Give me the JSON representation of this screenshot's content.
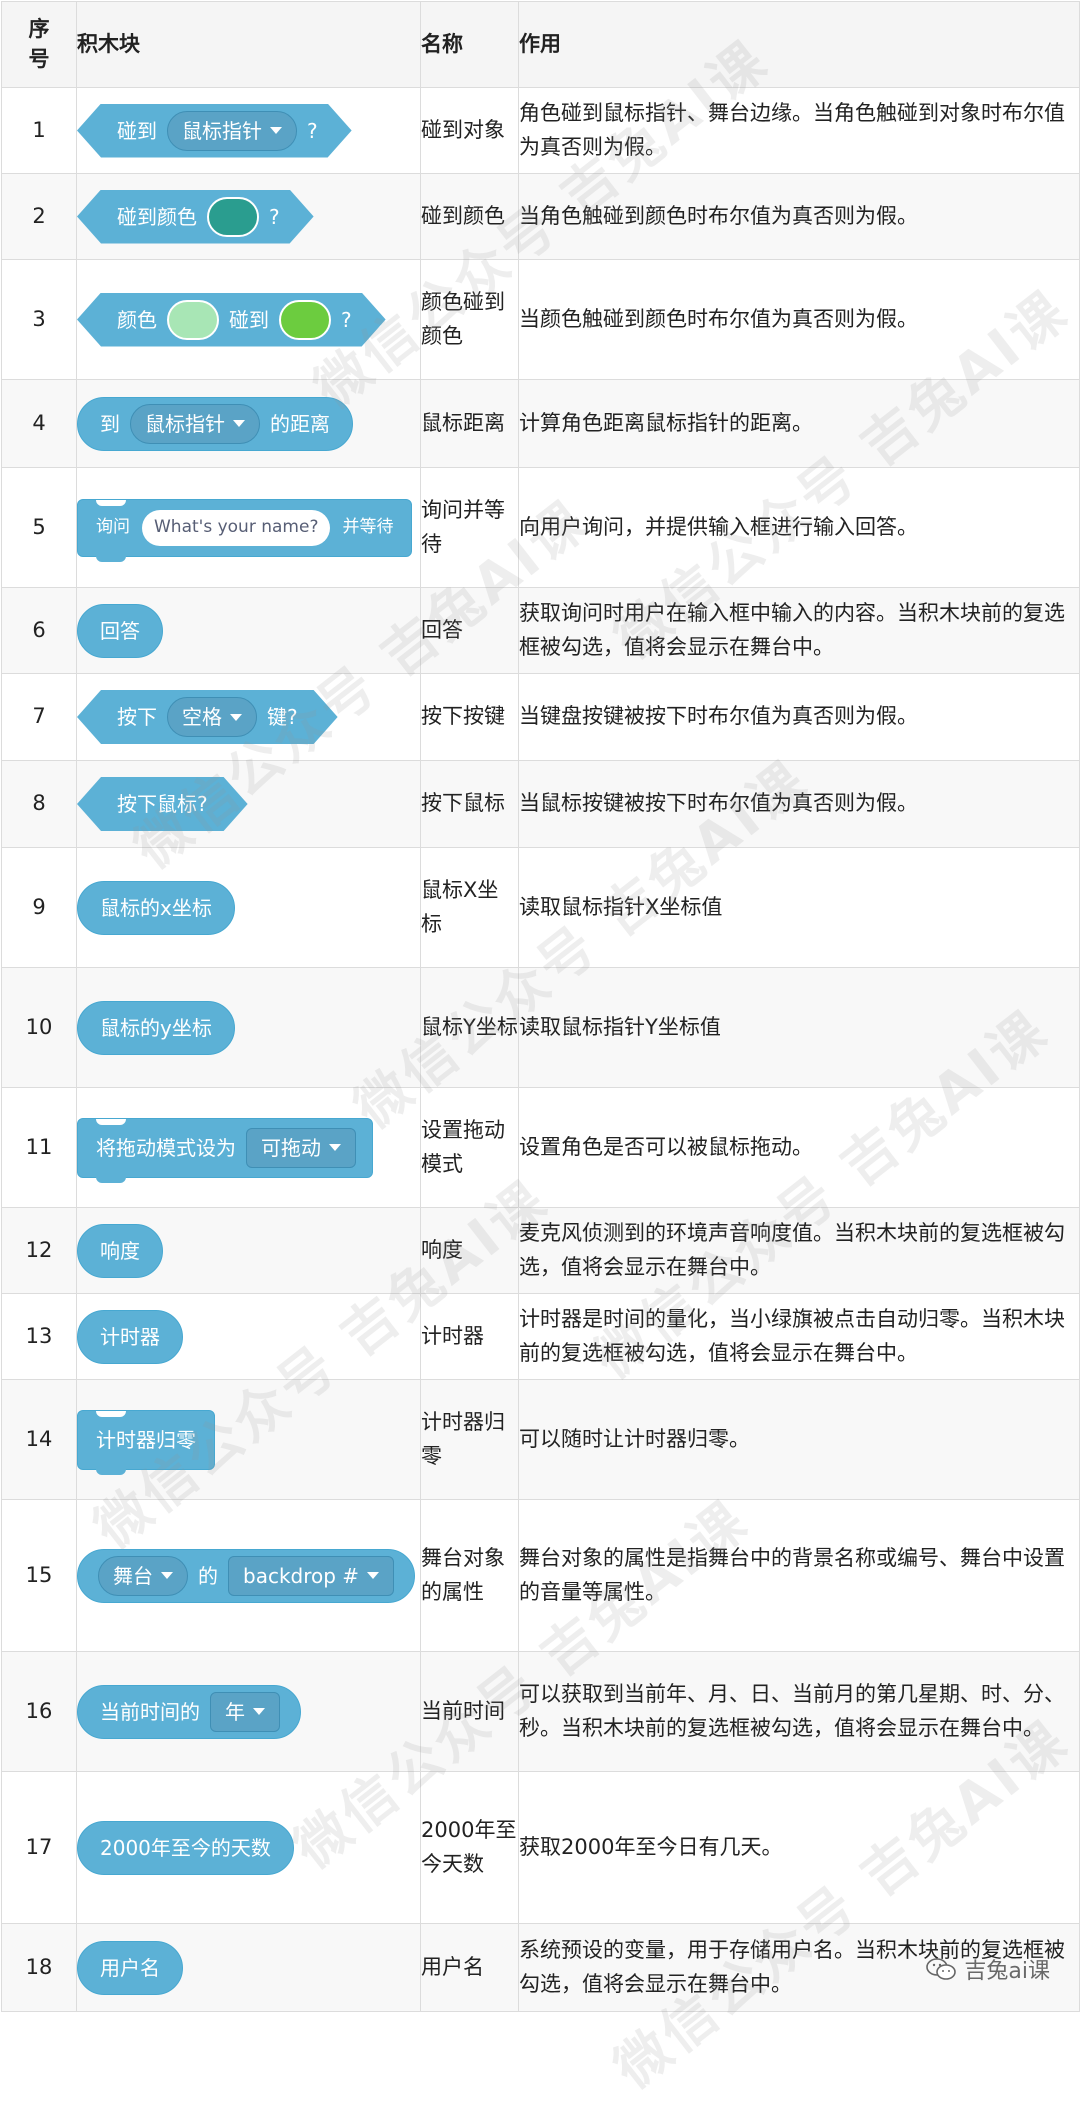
{
  "header": {
    "index": "序号",
    "block": "积木块",
    "name": "名称",
    "desc": "作用"
  },
  "rows": [
    {
      "idx": "1",
      "name": "碰到对象",
      "desc": "角色碰到鼠标指针、舞台边缘。当角色触碰到对象时布尔值为真否则为假。",
      "block": {
        "pre": "碰到",
        "dropdown": "鼠标指针",
        "post": "?"
      }
    },
    {
      "idx": "2",
      "name": "碰到颜色",
      "desc": "当角色触碰到颜色时布尔值为真否则为假。",
      "block": {
        "pre": "碰到颜色",
        "post": "?",
        "color": "#2a9d8f"
      }
    },
    {
      "idx": "3",
      "name": "颜色碰到颜色",
      "desc": "当颜色触碰到颜色时布尔值为真否则为假。",
      "block": {
        "pre": "颜色",
        "mid": "碰到",
        "post": "?",
        "color1": "#a8e6b5",
        "color2": "#6ccc3f"
      }
    },
    {
      "idx": "4",
      "name": "鼠标距离",
      "desc": "计算角色距离鼠标指针的距离。",
      "block": {
        "pre": "到",
        "dropdown": "鼠标指针",
        "post": "的距离"
      }
    },
    {
      "idx": "5",
      "name": "询问并等待",
      "desc": "向用户询问，并提供输入框进行输入回答。",
      "block": {
        "pre": "询问",
        "input": "What's your name?",
        "post": "并等待"
      }
    },
    {
      "idx": "6",
      "name": "回答",
      "desc": "获取询问时用户在输入框中输入的内容。当积木块前的复选框被勾选，值将会显示在舞台中。",
      "block": {
        "text": "回答"
      }
    },
    {
      "idx": "7",
      "name": "按下按键",
      "desc": "当键盘按键被按下时布尔值为真否则为假。",
      "block": {
        "pre": "按下",
        "dropdown": "空格",
        "post": "键?"
      }
    },
    {
      "idx": "8",
      "name": "按下鼠标",
      "desc": "当鼠标按键被按下时布尔值为真否则为假。",
      "block": {
        "text": "按下鼠标?"
      }
    },
    {
      "idx": "9",
      "name": "鼠标X坐标",
      "desc": "读取鼠标指针X坐标值",
      "block": {
        "text": "鼠标的x坐标"
      }
    },
    {
      "idx": "10",
      "name": "鼠标Y坐标",
      "desc": "读取鼠标指针Y坐标值",
      "block": {
        "text": "鼠标的y坐标"
      }
    },
    {
      "idx": "11",
      "name": "设置拖动模式",
      "desc": "设置角色是否可以被鼠标拖动。",
      "block": {
        "pre": "将拖动模式设为",
        "dropdown": "可拖动"
      }
    },
    {
      "idx": "12",
      "name": "响度",
      "desc": "麦克风侦测到的环境声音响度值。当积木块前的复选框被勾选，值将会显示在舞台中。",
      "block": {
        "text": "响度"
      }
    },
    {
      "idx": "13",
      "name": "计时器",
      "desc": "计时器是时间的量化，当小绿旗被点击自动归零。当积木块前的复选框被勾选，值将会显示在舞台中。",
      "block": {
        "text": "计时器"
      }
    },
    {
      "idx": "14",
      "name": "计时器归零",
      "desc": "可以随时让计时器归零。",
      "block": {
        "text": "计时器归零"
      }
    },
    {
      "idx": "15",
      "name": "舞台对象的属性",
      "desc": "舞台对象的属性是指舞台中的背景名称或编号、舞台中设置的音量等属性。",
      "block": {
        "dropdown1": "舞台",
        "mid": "的",
        "dropdown2": "backdrop #"
      }
    },
    {
      "idx": "16",
      "name": "当前时间",
      "desc": "可以获取到当前年、月、日、当前月的第几星期、时、分、秒。当积木块前的复选框被勾选，值将会显示在舞台中。",
      "block": {
        "pre": "当前时间的",
        "dropdown": "年"
      }
    },
    {
      "idx": "17",
      "name": "2000年至今天数",
      "desc": "获取2000年至今日有几天。",
      "block": {
        "text": "2000年至今的天数"
      }
    },
    {
      "idx": "18",
      "name": "用户名",
      "desc": "系统预设的变量，用于存储用户名。当积木块前的复选框被勾选，值将会显示在舞台中。",
      "block": {
        "text": "用户名"
      }
    }
  ],
  "brand": {
    "label": "吉兔ai课",
    "icon": "wechat-icon"
  },
  "watermark": {
    "text": "微信公众号 吉兔AI课"
  },
  "colors": {
    "block": "#5cb1d6",
    "dropdown": "#5aa3c6",
    "border": "#dcdcdc"
  }
}
